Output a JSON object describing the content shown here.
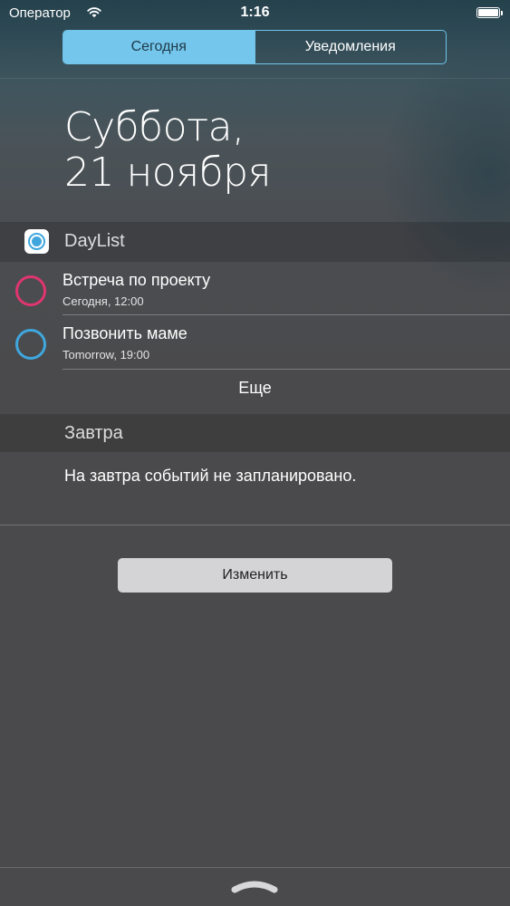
{
  "status_bar": {
    "carrier": "Оператор",
    "time": "1:16",
    "battery_level": 1.0
  },
  "segmented": {
    "today": "Сегодня",
    "notifications": "Уведомления"
  },
  "date": {
    "line1": "Суббота,",
    "line2": "21 ноября"
  },
  "widget": {
    "app_name": "DayList",
    "tasks": [
      {
        "title": "Встреча по проекту",
        "subtitle": "Сегодня, 12:00",
        "color": "#e0356e"
      },
      {
        "title": "Позвонить маме",
        "subtitle": "Tomorrow, 19:00",
        "color": "#3fa7de"
      }
    ],
    "more_label": "Еще"
  },
  "tomorrow": {
    "header": "Завтра",
    "empty_text": "На завтра событий не запланировано."
  },
  "edit_label": "Изменить",
  "colors": {
    "accent": "#74c6ec",
    "app_blue": "#3fa7de",
    "task_pink": "#e0356e"
  }
}
